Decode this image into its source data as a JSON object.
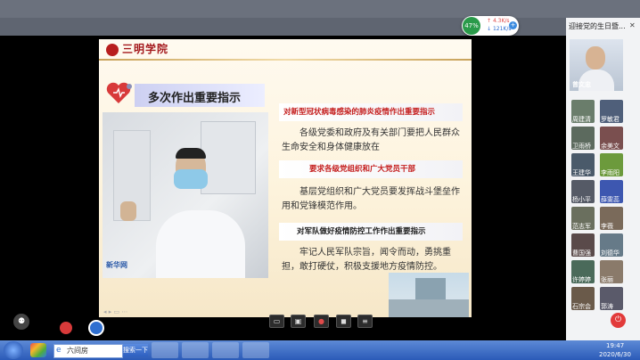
{
  "network": {
    "percent": "47%",
    "up": "4.3K/s",
    "down": "121K/s"
  },
  "meeting": {
    "title": "迎接党的生日暨..."
  },
  "slide": {
    "logo": "三明学院",
    "title": "多次作出重要指示",
    "photo_source": "新华网",
    "sections": [
      {
        "heading": "对新型冠状病毒感染的肺炎疫情作出重要指示",
        "heading_color": "#c41d1d",
        "body": "各级党委和政府及有关部门要把人民群众生命安全和身体健康放在"
      },
      {
        "heading": "要求各级党组织和广大党员干部",
        "heading_color": "#c41d1d",
        "body": "基层党组织和广大党员要发挥战斗堡垒作用和党锋模范作用。"
      },
      {
        "heading": "对军队做好疫情防控工作作出重要指示",
        "heading_color": "#1a1a1a",
        "body": "牢记人民军队宗旨，闻令而动，勇挑重担，敢打硬仗，积极支援地方疫情防控。"
      }
    ]
  },
  "speaker": {
    "name": "曾文忠"
  },
  "participants": [
    {
      "name": "周建清",
      "color": "#6a7d6b"
    },
    {
      "name": "罗敏君",
      "color": "#4f5f7a"
    },
    {
      "name": "卫雨桥",
      "color": "#5c6a5e"
    },
    {
      "name": "余美文",
      "color": "#7a4f4f"
    },
    {
      "name": "王建华",
      "color": "#4a5a6a"
    },
    {
      "name": "李雨阳",
      "color": "#6c9a3c"
    },
    {
      "name": "杨小平",
      "color": "#555a66"
    },
    {
      "name": "薛雯蕊",
      "color": "#3d57b0"
    },
    {
      "name": "范志军",
      "color": "#6a6f5e"
    },
    {
      "name": "李薇",
      "color": "#7a6a5a"
    },
    {
      "name": "曹国强",
      "color": "#5a4a4a"
    },
    {
      "name": "刘德华",
      "color": "#667a88"
    },
    {
      "name": "许婷婷",
      "color": "#4a6a5a"
    },
    {
      "name": "张丽",
      "color": "#8a7a6a"
    },
    {
      "name": "石宗会",
      "color": "#6a5a4a"
    },
    {
      "name": "郭涛",
      "color": "#5a5a6a"
    }
  ],
  "taskbar": {
    "search_placeholder": "六间房",
    "search_button": "搜索一下",
    "time": "19:47",
    "date": "2020/6/30"
  },
  "colors": {
    "accent": "#2a8f4a",
    "record": "#e23a3a",
    "taskbar": "#2b5bb8"
  }
}
